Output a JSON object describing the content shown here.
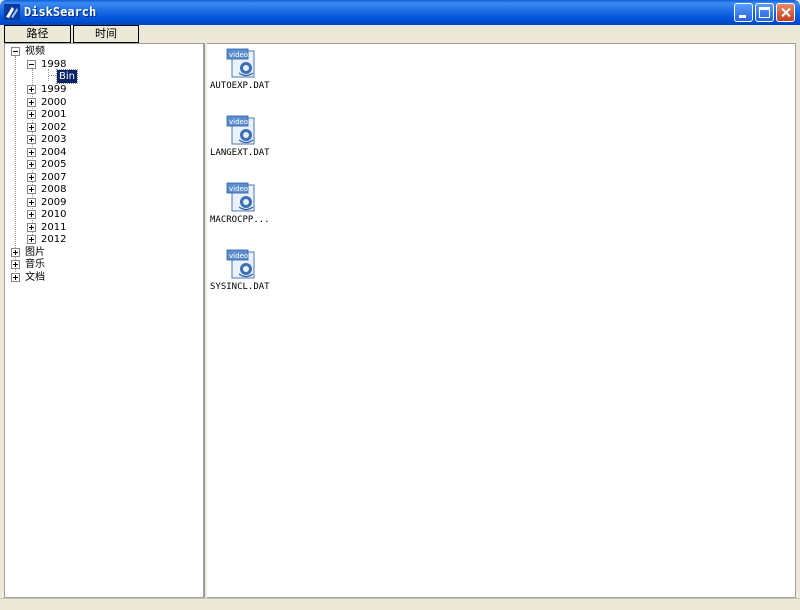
{
  "window": {
    "title": "DiskSearch"
  },
  "tabs": {
    "path_label": "路径",
    "time_label": "时间"
  },
  "tree": {
    "video": {
      "label": "视频",
      "years": [
        "1998",
        "1999",
        "2000",
        "2001",
        "2002",
        "2003",
        "2004",
        "2005",
        "2007",
        "2008",
        "2009",
        "2010",
        "2011",
        "2012"
      ],
      "expanded_year": "1998",
      "selected_child": "Bin"
    },
    "pictures": {
      "label": "图片"
    },
    "music": {
      "label": "音乐"
    },
    "docs": {
      "label": "文档"
    }
  },
  "files": [
    {
      "name": "AUTOEXP.DAT",
      "icon_text": "video"
    },
    {
      "name": "LANGEXT.DAT",
      "icon_text": "video"
    },
    {
      "name": "MACROCPP...",
      "icon_text": "video"
    },
    {
      "name": "SYSINCL.DAT",
      "icon_text": "video"
    }
  ],
  "colors": {
    "titlebar": "#0053d9",
    "selection": "#0a246a",
    "window_bg": "#ece9d8"
  }
}
